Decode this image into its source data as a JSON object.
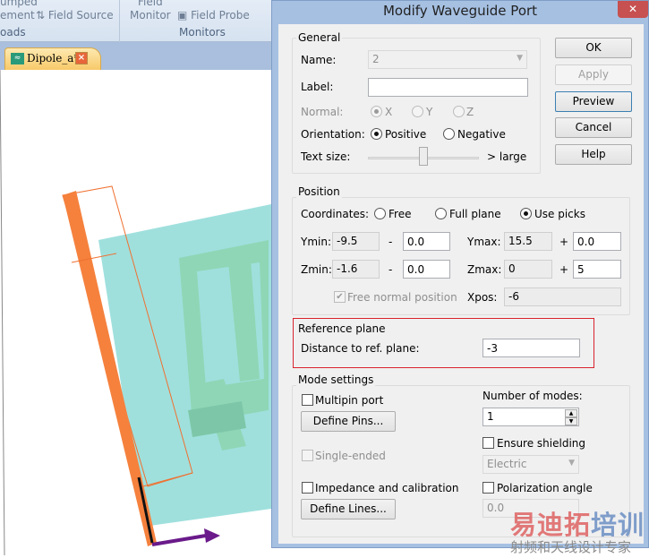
{
  "ribbon": {
    "items": [
      "umped",
      "ement",
      "Field Source",
      "oads",
      "Field",
      "Monitor",
      "Field Probe",
      "Monitors"
    ]
  },
  "doc_tab": {
    "label": "Dipole_a*"
  },
  "dialog": {
    "title": "Modify Waveguide Port",
    "buttons": {
      "ok": "OK",
      "apply": "Apply",
      "preview": "Preview",
      "cancel": "Cancel",
      "help": "Help"
    },
    "general": {
      "title": "General",
      "name_label": "Name:",
      "name_value": "2",
      "label_label": "Label:",
      "label_value": "",
      "normal_label": "Normal:",
      "normal_options": [
        "X",
        "Y",
        "Z"
      ],
      "normal_selected": "X",
      "orientation_label": "Orientation:",
      "orientation_options": [
        "Positive",
        "Negative"
      ],
      "orientation_selected": "Positive",
      "text_size_label": "Text size:",
      "text_size_max": "> large",
      "text_size_level": 0.5
    },
    "position": {
      "title": "Position",
      "coordinates_label": "Coordinates:",
      "coordinates_options": [
        "Free",
        "Full plane",
        "Use picks"
      ],
      "coordinates_selected": "Use picks",
      "ymin_label": "Ymin:",
      "ymin": "-9.5",
      "ymin_offset": "0.0",
      "ymax_label": "Ymax:",
      "ymax": "15.5",
      "ymax_offset": "0.0",
      "zmin_label": "Zmin:",
      "zmin": "-1.6",
      "zmin_offset": "0.0",
      "zmax_label": "Zmax:",
      "zmax": "0",
      "zmax_offset": "5",
      "minus": "-",
      "plus": "+",
      "free_normal_label": "Free normal position",
      "free_normal_checked": true,
      "xpos_label": "Xpos:",
      "xpos": "-6"
    },
    "reference": {
      "title": "Reference plane",
      "distance_label": "Distance to ref. plane:",
      "distance": "-3",
      "highlight_color": "#d9232e"
    },
    "mode": {
      "title": "Mode settings",
      "multipin_label": "Multipin port",
      "define_pins": "Define Pins...",
      "modes_label": "Number of modes:",
      "modes": "1",
      "shielding_label": "Ensure shielding",
      "shielding_value": "Electric",
      "single_ended_label": "Single-ended",
      "impedance_label": "Impedance and calibration",
      "define_lines": "Define Lines...",
      "polarization_label": "Polarization angle",
      "polarization_value": "0.0"
    }
  },
  "watermark": {
    "line1a": "易迪拓",
    "line1b": "培训",
    "line2": "射频和天线设计专家"
  }
}
